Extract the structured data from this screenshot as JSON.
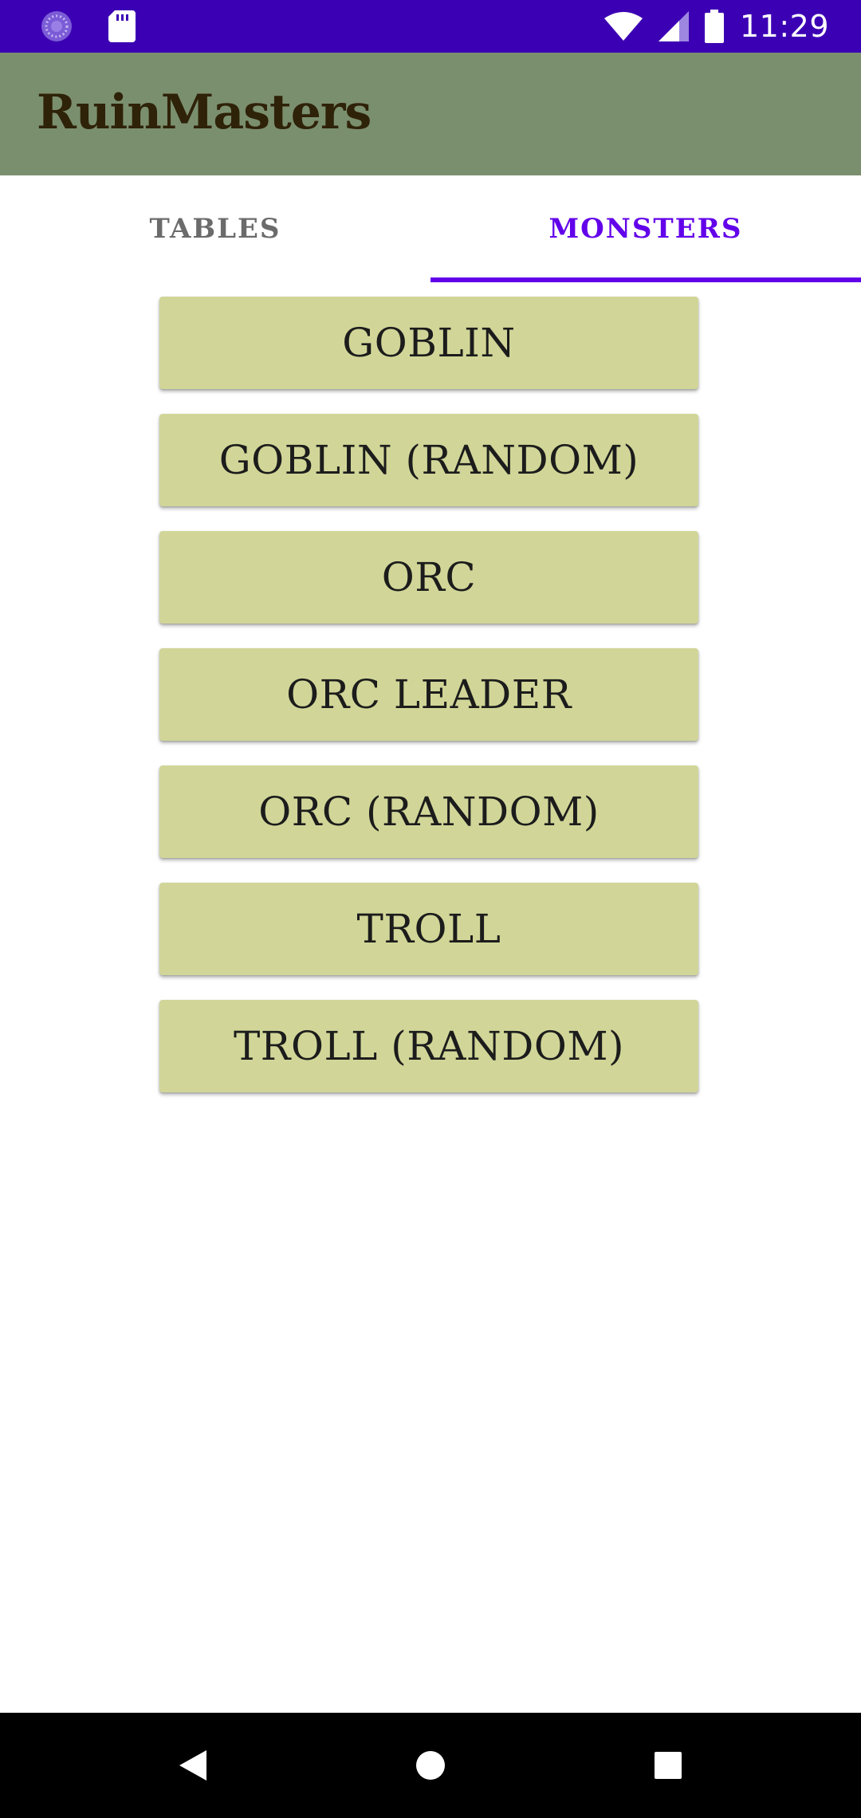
{
  "status_bar": {
    "time": "11:29",
    "left_icons": [
      "loading-icon",
      "sd-card-icon"
    ],
    "right_icons": [
      "wifi-icon",
      "signal-icon",
      "battery-icon"
    ],
    "background_color": "#3c00b4"
  },
  "app_bar": {
    "title": "RuinMasters",
    "background_color": "#7a8f6e"
  },
  "tabs": [
    {
      "label": "TABLES",
      "active": false
    },
    {
      "label": "MONSTERS",
      "active": true
    }
  ],
  "accent_color": "#6200ea",
  "monsters": [
    {
      "label": "GOBLIN"
    },
    {
      "label": "GOBLIN (RANDOM)"
    },
    {
      "label": "ORC"
    },
    {
      "label": "ORC LEADER"
    },
    {
      "label": "ORC (RANDOM)"
    },
    {
      "label": "TROLL"
    },
    {
      "label": "TROLL (RANDOM)"
    }
  ],
  "button_color": "#d1d698",
  "nav_bar": {
    "buttons": [
      "back-icon",
      "home-icon",
      "recents-icon"
    ]
  }
}
